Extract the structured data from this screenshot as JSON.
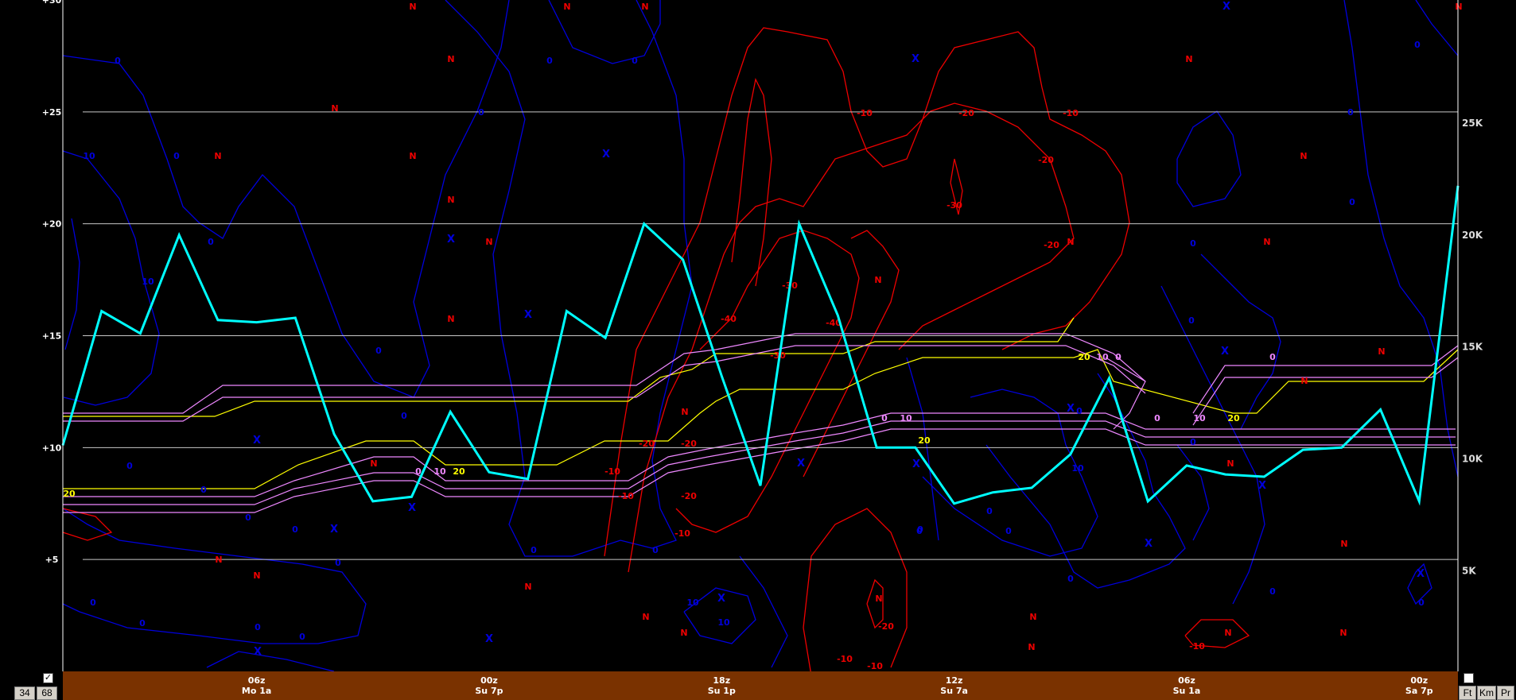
{
  "chart_data": {
    "type": "line",
    "title": "",
    "xlabel": "",
    "ylabel": "",
    "y_left_ticks": [
      "+5",
      "+10",
      "+15",
      "+20",
      "+25",
      "+30"
    ],
    "y_right_ticks": [
      "5K",
      "10K",
      "15K",
      "20K",
      "25K"
    ],
    "y_left_range": [
      0,
      30
    ],
    "x_time_labels": [
      {
        "z": "06z",
        "local": "Mo 1a",
        "i": 5
      },
      {
        "z": "00z",
        "local": "Su 7p",
        "i": 11
      },
      {
        "z": "18z",
        "local": "Su 1p",
        "i": 17
      },
      {
        "z": "12z",
        "local": "Su 7a",
        "i": 23
      },
      {
        "z": "06z",
        "local": "Su 1a",
        "i": 29
      },
      {
        "z": "00z",
        "local": "Sa 7p",
        "i": 35
      }
    ],
    "grid": true,
    "series": [
      {
        "name": "",
        "color": "#00ffff",
        "values": [
          10.1,
          16.1,
          15.1,
          19.5,
          15.7,
          15.6,
          15.8,
          10.6,
          7.6,
          7.8,
          11.6,
          8.9,
          8.6,
          16.1,
          14.9,
          20.0,
          18.4,
          13.2,
          8.3,
          20.0,
          15.9,
          10.0,
          10.0,
          7.5,
          8.0,
          8.2,
          9.7,
          13.1,
          7.6,
          9.2,
          8.8,
          8.7,
          9.9,
          10.0,
          11.7,
          7.6,
          21.7
        ]
      }
    ],
    "colors": {
      "grid": "#c8c8c8",
      "axis_text": "#ffffff",
      "blue_contour": "#0000dd",
      "red_contour": "#ee0000",
      "yellow_line": "#ffff00",
      "violet_line": "#ee88ff",
      "cyan_series": "#00ffff",
      "time_axis_bg": "#7a3200"
    }
  },
  "contour_labels": {
    "blue": [
      "0",
      "10"
    ],
    "red": [
      "-10",
      "-20",
      "-30",
      "-40"
    ],
    "yellow": [
      "20"
    ],
    "violet": [
      "0",
      "10"
    ]
  },
  "markers": {
    "red": "N",
    "blue": "X"
  },
  "controls": {
    "value_a": "34",
    "value_b": "68",
    "check_left": "✓",
    "check_right": "",
    "units": [
      "Ft",
      "Km",
      "Pr"
    ]
  }
}
